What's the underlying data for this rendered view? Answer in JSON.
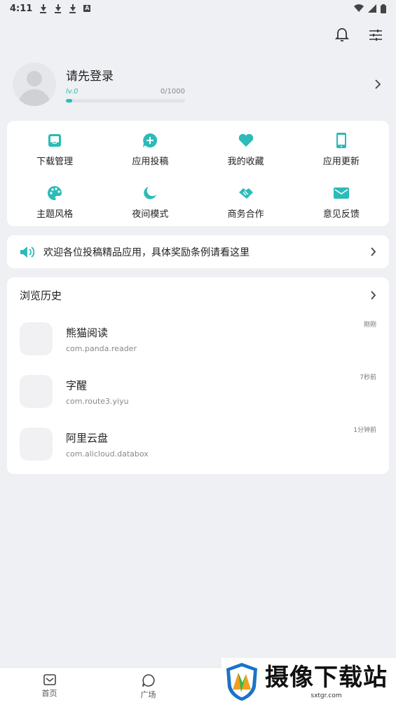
{
  "status_bar": {
    "time": "4:11",
    "sim_label": "A"
  },
  "profile": {
    "login_prompt": "请先登录",
    "level": "lv.0",
    "exp": "0/1000",
    "progress_fraction": 0.05
  },
  "grid": [
    {
      "label": "下载管理",
      "icon": "inbox-icon"
    },
    {
      "label": "应用投稿",
      "icon": "chat-plus-icon"
    },
    {
      "label": "我的收藏",
      "icon": "heart-icon"
    },
    {
      "label": "应用更新",
      "icon": "phone-icon"
    },
    {
      "label": "主题风格",
      "icon": "palette-icon"
    },
    {
      "label": "夜间模式",
      "icon": "moon-icon"
    },
    {
      "label": "商务合作",
      "icon": "handshake-icon"
    },
    {
      "label": "意见反馈",
      "icon": "mail-icon"
    }
  ],
  "notice": {
    "text": "欢迎各位投稿精品应用，具体奖励条例请看这里"
  },
  "history": {
    "title": "浏览历史",
    "items": [
      {
        "name": "熊猫阅读",
        "package": "com.panda.reader",
        "time": "刚刚"
      },
      {
        "name": "字醒",
        "package": "com.route3.yiyu",
        "time": "7秒前"
      },
      {
        "name": "阿里云盘",
        "package": "com.alicloud.databox",
        "time": "1分钟前"
      }
    ]
  },
  "bottom_nav": [
    {
      "label": "首页",
      "icon": "home-mail-icon"
    },
    {
      "label": "广场",
      "icon": "chat-bubble-icon"
    }
  ],
  "watermark": {
    "title": "摄像下载站",
    "url": "sxtgr.com"
  },
  "colors": {
    "accent": "#2bbbb8",
    "background": "#eff0f3",
    "card": "#ffffff"
  }
}
